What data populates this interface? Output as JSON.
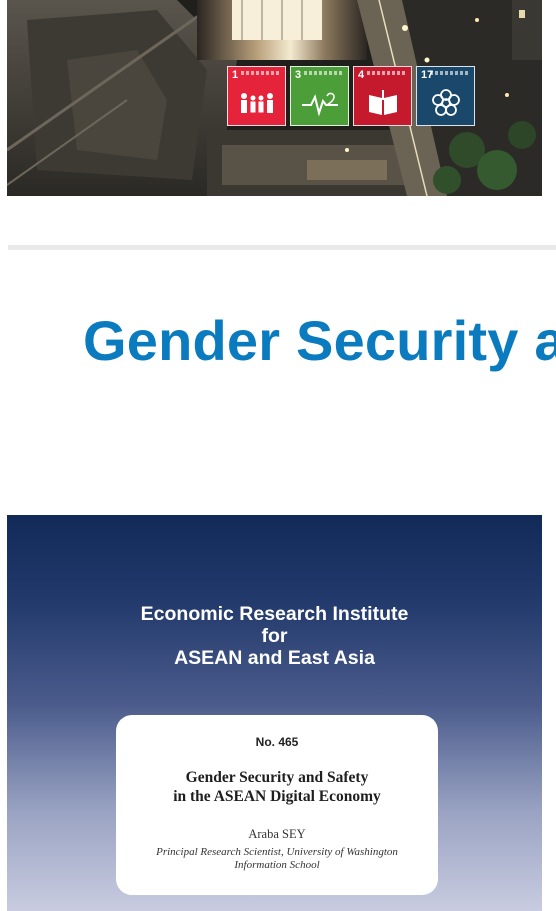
{
  "banner": {
    "image_description": "night aerial view of a building with SDG goal tiles",
    "sdg_tiles": [
      {
        "number": "1",
        "color": "#e5243b",
        "icon": "people-icon"
      },
      {
        "number": "3",
        "color": "#4c9f38",
        "icon": "heartbeat-icon"
      },
      {
        "number": "4",
        "color": "#c5192d",
        "icon": "book-icon"
      },
      {
        "number": "17",
        "color": "#19486a",
        "icon": "flower-icon"
      }
    ]
  },
  "article": {
    "title": "Gender Security and Safety in the ASEAN Digital Economy",
    "title_color": "#0b7bbf"
  },
  "cover": {
    "institute_line1": "Economic Research Institute",
    "institute_line2": "for",
    "institute_line3": "ASEAN and East Asia",
    "number": "No. 465",
    "report_title_line1": "Gender Security and Safety",
    "report_title_line2": "in the ASEAN Digital Economy",
    "author": "Araba SEY",
    "affiliation_line1": "Principal Research Scientist, University of Washington",
    "affiliation_line2": "Information School",
    "background_top": "#122a58",
    "background_bottom": "#c9cce0"
  }
}
